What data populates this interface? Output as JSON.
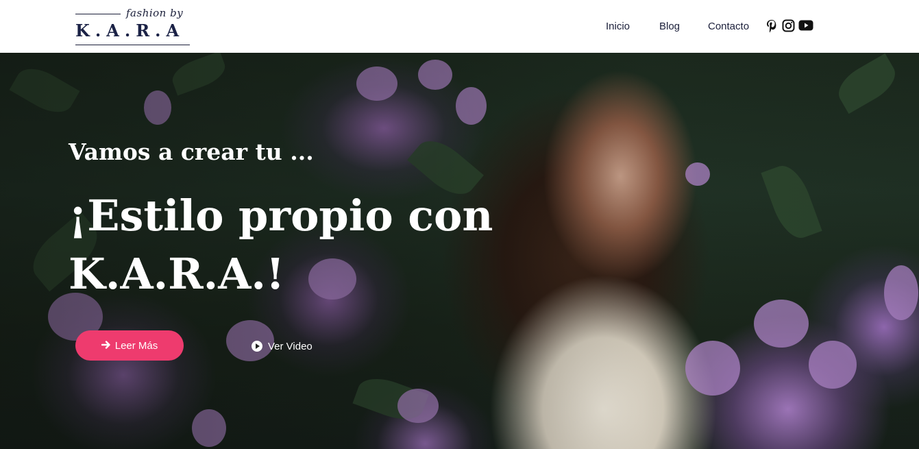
{
  "logo": {
    "script": "fashion by",
    "word": "K.A.R.A"
  },
  "nav": {
    "items": [
      {
        "label": "Inicio"
      },
      {
        "label": "Blog"
      },
      {
        "label": "Contacto"
      }
    ]
  },
  "social": {
    "icons": [
      "pinterest-icon",
      "instagram-icon",
      "youtube-icon"
    ]
  },
  "hero": {
    "subtitle": "Vamos a crear tu ...",
    "title": "¡Estilo propio con K.A.R.A.!",
    "primary_button": {
      "label": "Leer Más",
      "icon": "arrow-right-icon"
    },
    "video_button": {
      "label": "Ver Video",
      "icon": "play-icon"
    }
  },
  "colors": {
    "accent": "#ee3b6e",
    "brand_navy": "#1b2246",
    "text_light": "#ffffff"
  }
}
